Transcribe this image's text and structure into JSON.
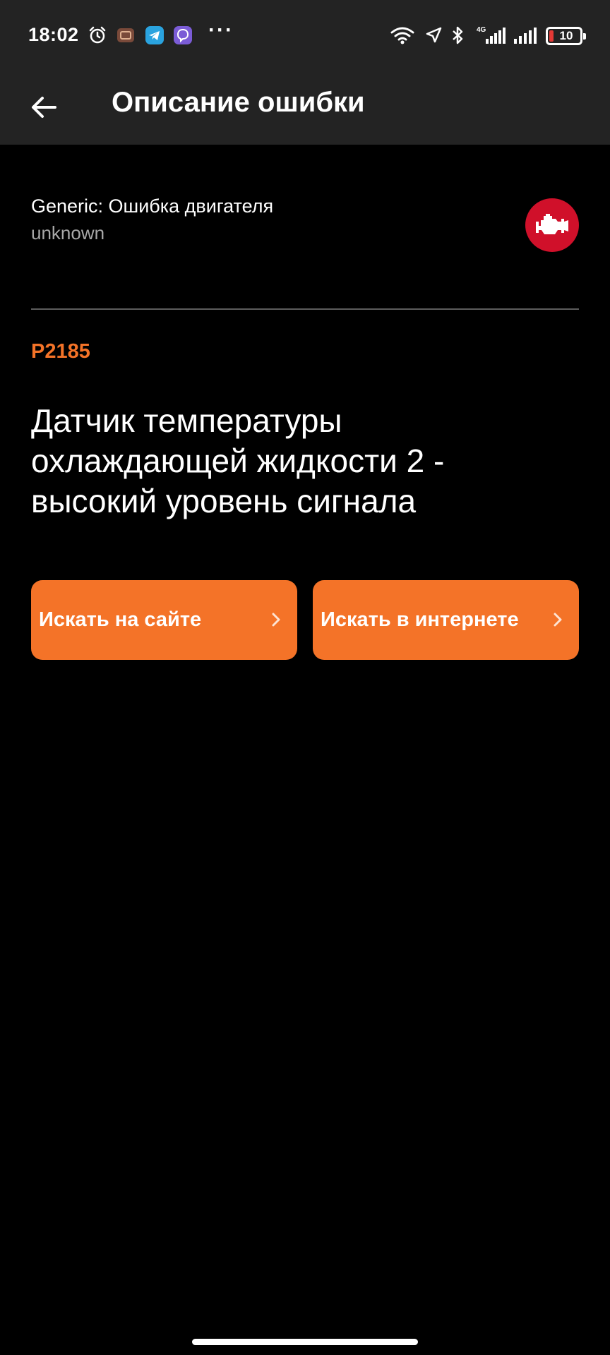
{
  "status_bar": {
    "time": "18:02",
    "icons": [
      "alarm-icon",
      "notification-app-icon",
      "telegram-icon",
      "viber-icon",
      "wifi-icon",
      "location-icon",
      "bluetooth-icon",
      "signal-4g-icon",
      "signal-icon",
      "battery-icon"
    ],
    "more_indicator": "···",
    "network_type": "4G",
    "battery_level": "10"
  },
  "app_bar": {
    "title": "Описание ошибки",
    "back_icon": "arrow-left-icon"
  },
  "error": {
    "vehicle": "Generic: Ошибка двигателя",
    "subtitle": "unknown",
    "badge_icon": "check-engine-icon",
    "code": "P2185",
    "description": "Датчик температуры охлаждающей жидкости 2 - высокий уровень сигнала"
  },
  "actions": {
    "search_site_label": "Искать на сайте",
    "search_web_label": "Искать в интернете",
    "chevron_icon": "chevron-right-icon"
  },
  "colors": {
    "accent": "#f47328",
    "badge": "#d0102a",
    "bar_background": "#232323",
    "background": "#000000",
    "secondary_text": "#a8a8a8"
  }
}
